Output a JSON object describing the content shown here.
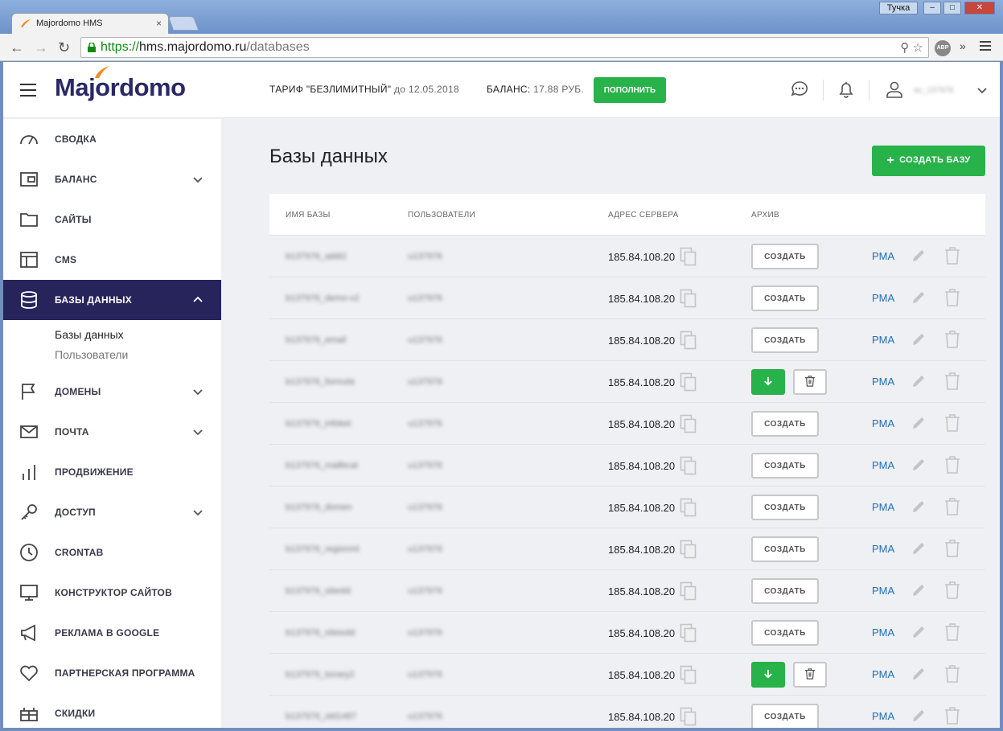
{
  "browser": {
    "tab_title": "Majordomo HMS",
    "tab_close": "×",
    "window_user": "Тучка",
    "url_scheme": "https://",
    "url_host": "hms.majordomo.ru",
    "url_path": "/databases",
    "abp_label": "ABP",
    "more_label": "»"
  },
  "header": {
    "logo": "Majordomo",
    "tariff_prefix": "ТАРИФ \"БЕЗЛИМИТНЫЙ\"",
    "tariff_until": "до 12.05.2018",
    "balance_label": "БАЛАНС:",
    "balance_value": "17.88 РУБ.",
    "topup_label": "ПОПОЛНИТЬ",
    "username": "ac_137976"
  },
  "sidebar": {
    "items": [
      {
        "label": "СВОДКА",
        "icon": "gauge-icon"
      },
      {
        "label": "БАЛАНС",
        "icon": "wallet-icon"
      },
      {
        "label": "САЙТЫ",
        "icon": "folder-icon"
      },
      {
        "label": "CMS",
        "icon": "layout-icon"
      },
      {
        "label": "БАЗЫ ДАННЫХ",
        "icon": "database-icon"
      },
      {
        "label": "ДОМЕНЫ",
        "icon": "flag-icon"
      },
      {
        "label": "ПОЧТА",
        "icon": "mail-icon"
      },
      {
        "label": "ПРОДВИЖЕНИЕ",
        "icon": "bar-chart-icon"
      },
      {
        "label": "ДОСТУП",
        "icon": "key-icon"
      },
      {
        "label": "CRONTAB",
        "icon": "clock-icon"
      },
      {
        "label": "КОНСТРУКТОР САЙТОВ",
        "icon": "monitor-icon"
      },
      {
        "label": "РЕКЛАМА В GOOGLE",
        "icon": "megaphone-icon"
      },
      {
        "label": "ПАРТНЕРСКАЯ ПРОГРАММА",
        "icon": "heart-icon"
      },
      {
        "label": "СКИДКИ",
        "icon": "gift-icon"
      }
    ],
    "sub_items": [
      "Базы данных",
      "Пользователи"
    ]
  },
  "main": {
    "title": "Базы данных",
    "create_label": "СОЗДАТЬ БАЗУ",
    "create_plus": "+",
    "columns": [
      "ИМЯ БАЗЫ",
      "ПОЛЬЗОВАТЕЛИ",
      "АДРЕС СЕРВЕРА",
      "АРХИВ"
    ],
    "archive_create_label": "СОЗДАТЬ",
    "pma_label": "PMA",
    "rows": [
      {
        "name": "b137976_addi2",
        "user": "u137976",
        "server": "185.84.108.20",
        "archive": "create"
      },
      {
        "name": "b137976_demo-v2",
        "user": "u137976",
        "server": "185.84.108.20",
        "archive": "create"
      },
      {
        "name": "b137976_email",
        "user": "u137976",
        "server": "185.84.108.20",
        "archive": "create"
      },
      {
        "name": "b137976_formula",
        "user": "u137976",
        "server": "185.84.108.20",
        "archive": "ready"
      },
      {
        "name": "b137976_infoket",
        "user": "u137976",
        "server": "185.84.108.20",
        "archive": "create"
      },
      {
        "name": "b137976_mallbcat",
        "user": "u137976",
        "server": "185.84.108.20",
        "archive": "create"
      },
      {
        "name": "b137976_domen",
        "user": "u137976",
        "server": "185.84.108.20",
        "archive": "create"
      },
      {
        "name": "b137976_regionmt",
        "user": "u137976",
        "server": "185.84.108.20",
        "archive": "create"
      },
      {
        "name": "b137976_siteold",
        "user": "u137976",
        "server": "185.84.108.20",
        "archive": "create"
      },
      {
        "name": "b137976_sitesold",
        "user": "u137976",
        "server": "185.84.108.20",
        "archive": "create"
      },
      {
        "name": "b137976_tonary2",
        "user": "u137976",
        "server": "185.84.108.20",
        "archive": "ready"
      },
      {
        "name": "b137976_old1487",
        "user": "u137976",
        "server": "185.84.108.20",
        "archive": "create"
      }
    ]
  },
  "colors": {
    "brand_navy": "#26245b",
    "accent_green": "#27b24a",
    "link_blue": "#1f6fb5",
    "logo_flame": "#f28a1e"
  }
}
